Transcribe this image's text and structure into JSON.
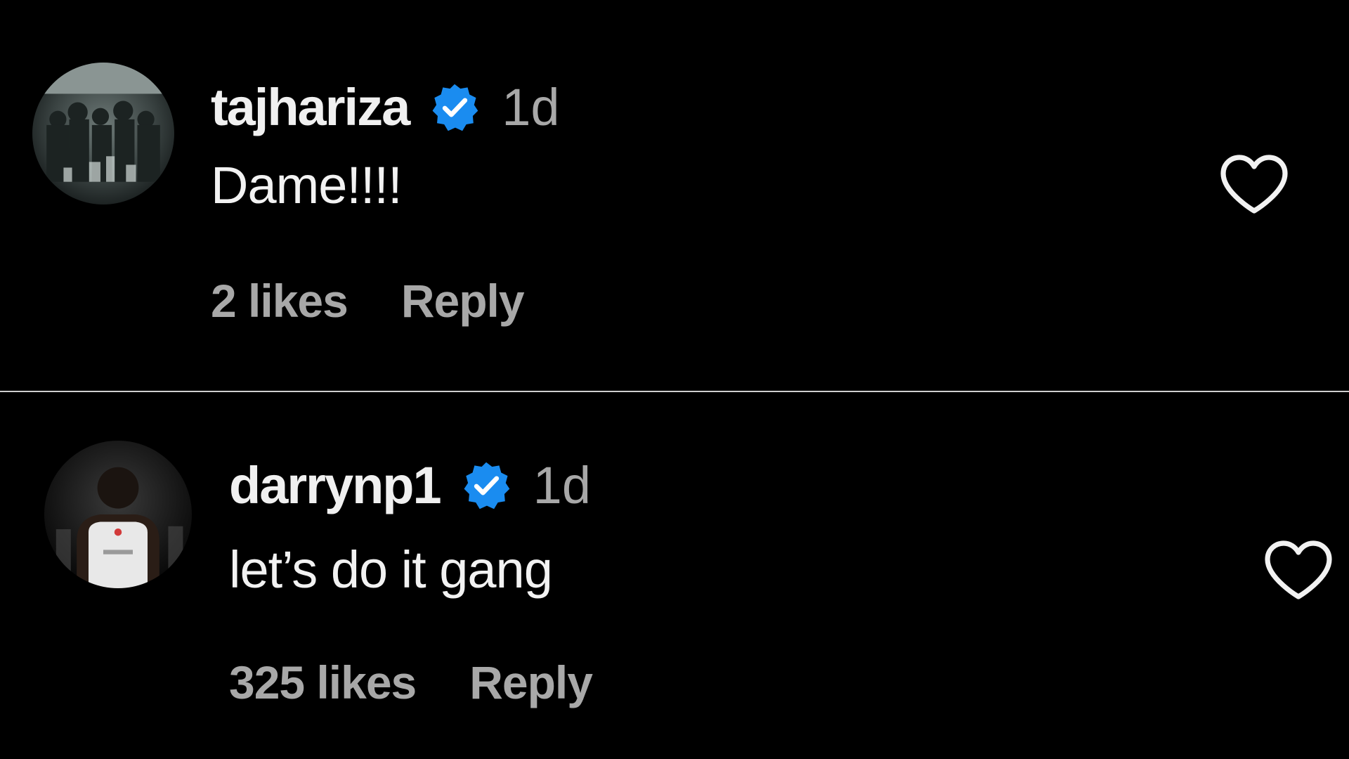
{
  "comments": [
    {
      "username": "tajhariza",
      "verified": true,
      "timestamp": "1d",
      "text": "Dame!!!!",
      "likes": "2 likes",
      "reply_label": "Reply",
      "avatar_icon": "crowd-photo-avatar",
      "like_icon": "heart-outline-icon"
    },
    {
      "username": "darrynp1",
      "verified": true,
      "timestamp": "1d",
      "text": "let’s do it gang",
      "likes": "325 likes",
      "reply_label": "Reply",
      "avatar_icon": "player-jersey-avatar",
      "like_icon": "heart-outline-icon"
    }
  ],
  "colors": {
    "background": "#000000",
    "username": "#f0f0f0",
    "secondary_text": "#a8a8a8",
    "verified_badge": "#1a8cf0",
    "divider": "#cfcfcf"
  }
}
